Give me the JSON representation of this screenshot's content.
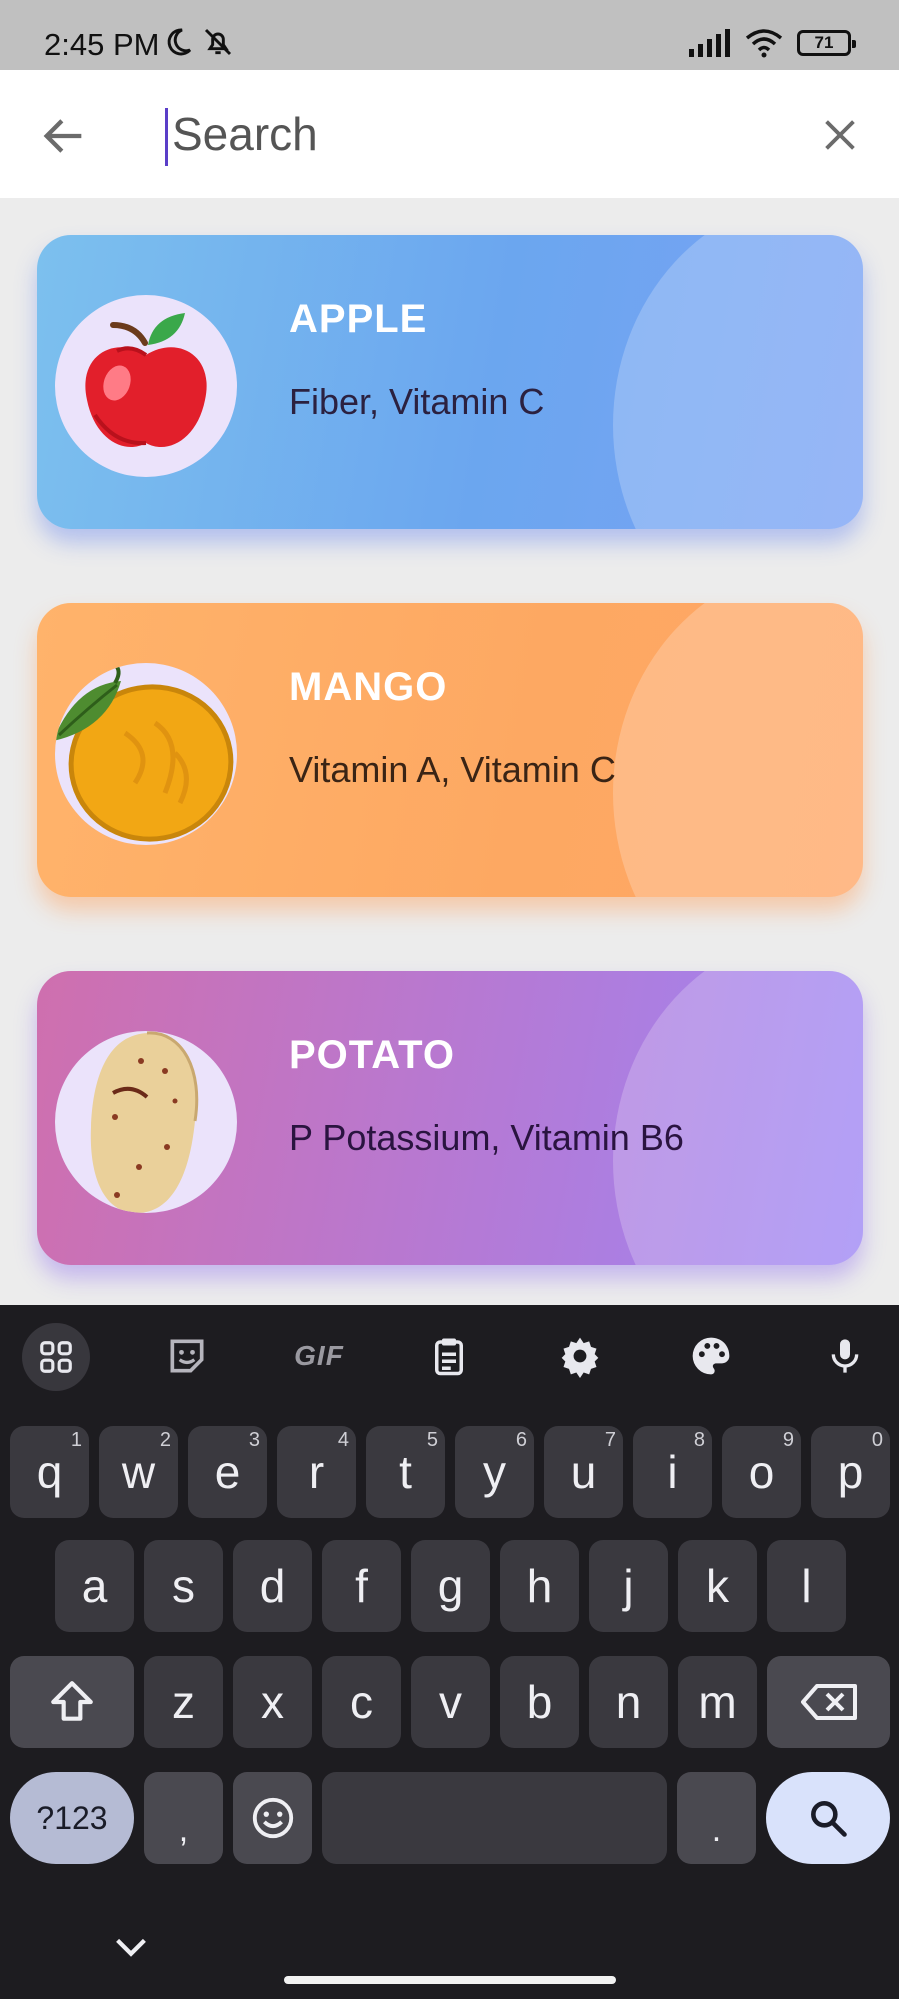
{
  "status_bar": {
    "time": "2:45 PM",
    "battery": "71",
    "icons_left": [
      "moon-icon",
      "bell-off-icon"
    ],
    "icons_right": [
      "signal-icon",
      "wifi-icon",
      "battery-icon"
    ]
  },
  "search": {
    "placeholder": "Search",
    "value": "",
    "back_icon": "arrow-left-icon",
    "clear_icon": "close-icon"
  },
  "items": [
    {
      "title": "APPLE",
      "nutrients": "Fiber, Vitamin C",
      "image": "apple"
    },
    {
      "title": "MANGO",
      "nutrients": "Vitamin A, Vitamin C",
      "image": "mango"
    },
    {
      "title": "POTATO",
      "nutrients": "P Potassium, Vitamin B6",
      "image": "potato"
    }
  ],
  "keyboard": {
    "toolbar": [
      "apps-grid-icon",
      "sticker-icon",
      "GIF",
      "clipboard-icon",
      "settings-gear-icon",
      "palette-icon",
      "mic-icon"
    ],
    "gif_label": "GIF",
    "row1": [
      {
        "k": "q",
        "h": "1"
      },
      {
        "k": "w",
        "h": "2"
      },
      {
        "k": "e",
        "h": "3"
      },
      {
        "k": "r",
        "h": "4"
      },
      {
        "k": "t",
        "h": "5"
      },
      {
        "k": "y",
        "h": "6"
      },
      {
        "k": "u",
        "h": "7"
      },
      {
        "k": "i",
        "h": "8"
      },
      {
        "k": "o",
        "h": "9"
      },
      {
        "k": "p",
        "h": "0"
      }
    ],
    "row2": [
      "a",
      "s",
      "d",
      "f",
      "g",
      "h",
      "j",
      "k",
      "l"
    ],
    "row3": [
      "z",
      "x",
      "c",
      "v",
      "b",
      "n",
      "m"
    ],
    "symbols_label": "?123",
    "comma_label": ",",
    "period_label": ".",
    "colors": {
      "background": "#1d1c20",
      "key": "#3a393f",
      "search_key": "#d9e2fb"
    }
  },
  "colors": {
    "apple_card": "#6ba6ef",
    "mango_card": "#fda862",
    "potato_card": "#b47ad6",
    "avatar_bg": "#ebe3fb"
  }
}
